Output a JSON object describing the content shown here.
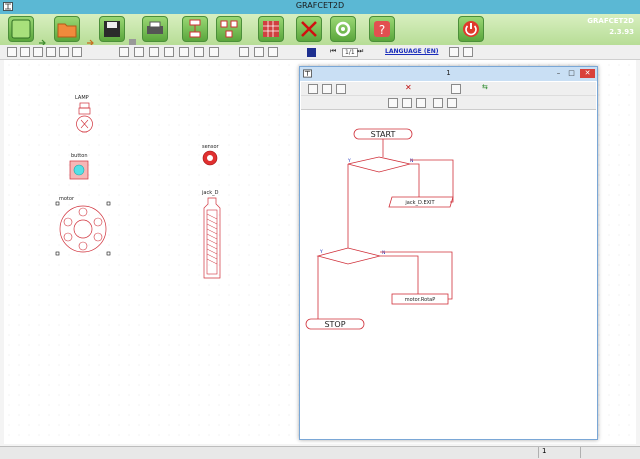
{
  "window": {
    "title": "GRAFCET2D"
  },
  "version": {
    "line1": "GRAFCET2D",
    "line2": "2.3.93"
  },
  "toolbar": {
    "language_label": "LANGUAGE (EN)",
    "page_indicator": "1/1"
  },
  "components": {
    "lamp_label": "LAMP",
    "button_label": "button",
    "sensor_label": "sensor",
    "motor_label": "motor",
    "jack_label": "jack_D"
  },
  "child_window": {
    "title": "1"
  },
  "flowchart": {
    "start": "START",
    "stop": "STOP",
    "yes1": "Y",
    "no1": "N",
    "yes2": "Y",
    "no2": "N",
    "action1": "jack_D.EXIT",
    "action2": "motor.RotaP"
  },
  "status": {
    "page": "1"
  },
  "colors": {
    "accent_green": "#5aa63c",
    "diagram_red": "#d0303a",
    "title_blue": "#5bb8d4"
  }
}
